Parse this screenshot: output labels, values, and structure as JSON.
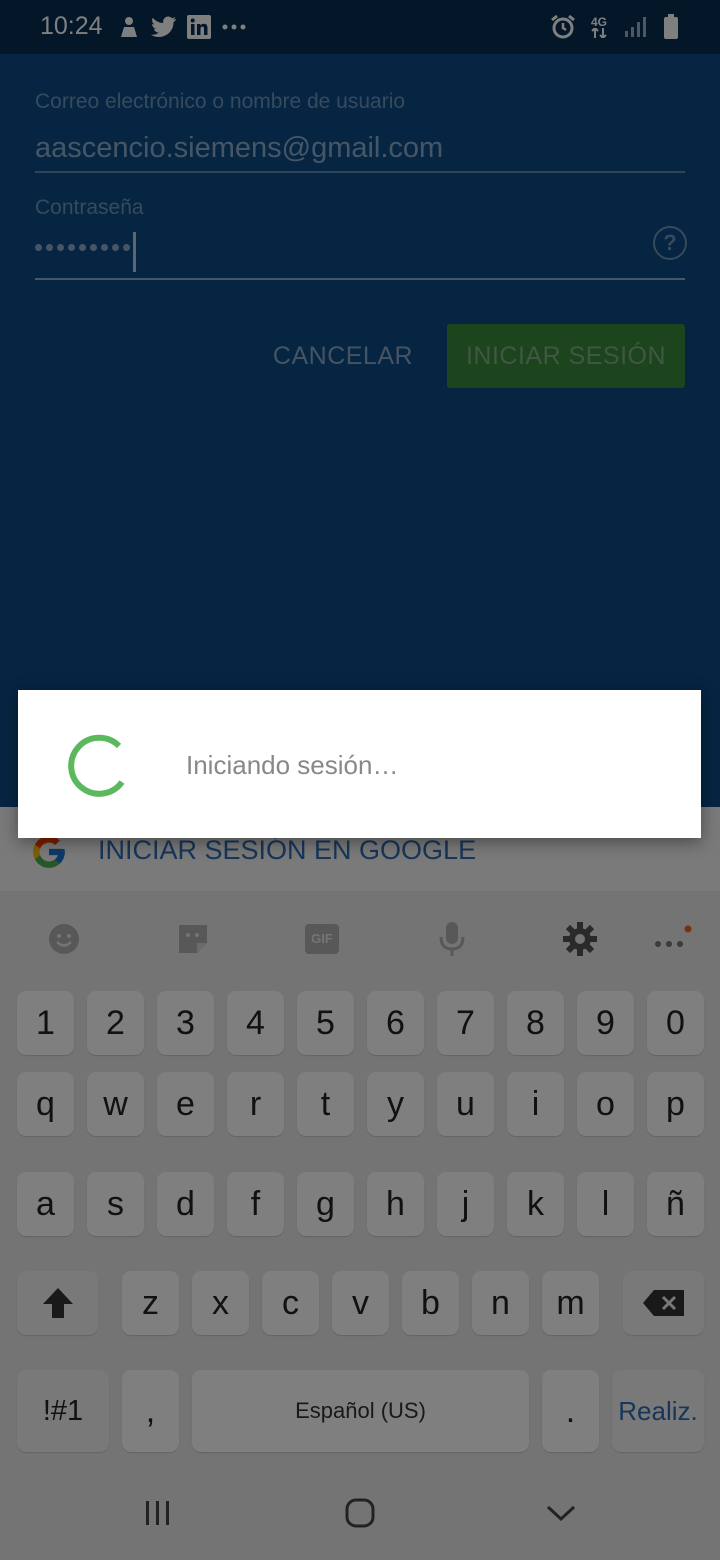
{
  "status_bar": {
    "time": "10:24",
    "left_icons": [
      "person-notification-icon",
      "twitter-icon",
      "linkedin-icon",
      "more-notifications-icon"
    ],
    "network_label": "4G",
    "right_icons": [
      "alarm-icon",
      "network-4g-icon",
      "signal-icon",
      "battery-icon"
    ]
  },
  "login": {
    "email_label": "Correo electrónico o nombre de usuario",
    "email_value": "aascencio.siemens@gmail.com",
    "password_label": "Contraseña",
    "password_masked_length": 9,
    "help_icon": "?",
    "cancel_label": "CANCELAR",
    "signin_label": "INICIAR SESIÓN"
  },
  "google": {
    "label": "INICIAR SESIÓN EN GOOGLE"
  },
  "dialog": {
    "message": "Iniciando sesión…"
  },
  "keyboard": {
    "toolbar_icons": [
      "emoji-icon",
      "sticker-icon",
      "gif-icon",
      "microphone-icon",
      "settings-icon",
      "more-icon"
    ],
    "gif_label": "GIF",
    "row_numbers": [
      "1",
      "2",
      "3",
      "4",
      "5",
      "6",
      "7",
      "8",
      "9",
      "0"
    ],
    "row_q": [
      "q",
      "w",
      "e",
      "r",
      "t",
      "y",
      "u",
      "i",
      "o",
      "p"
    ],
    "row_a": [
      "a",
      "s",
      "d",
      "f",
      "g",
      "h",
      "j",
      "k",
      "l",
      "ñ"
    ],
    "row_z": [
      "z",
      "x",
      "c",
      "v",
      "b",
      "n",
      "m"
    ],
    "symbols_label": "!#1",
    "comma_label": ",",
    "space_label": "Español (US)",
    "period_label": ".",
    "done_label": "Realiz."
  },
  "nav": {
    "icons": [
      "recent-apps-icon",
      "home-icon",
      "back-icon"
    ]
  },
  "colors": {
    "app_blue": "#0a4a86",
    "signin_green": "#3a8a3a",
    "spinner_green": "#5cb85c",
    "google_link_blue": "#2e6db4"
  }
}
